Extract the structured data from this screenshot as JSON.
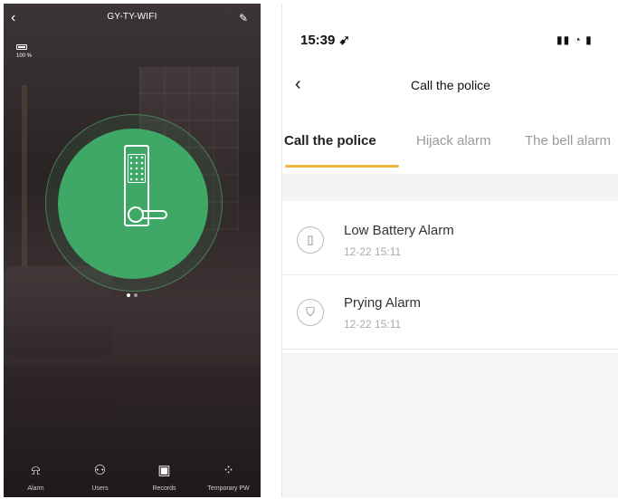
{
  "left": {
    "title": "GY-TY-WIFI",
    "battery": "100 %",
    "nav": [
      {
        "label": "Alarm",
        "icon": "alarm-icon"
      },
      {
        "label": "Users",
        "icon": "users-icon"
      },
      {
        "label": "Records",
        "icon": "calendar-icon"
      },
      {
        "label": "Temporary PW",
        "icon": "keypad-icon"
      }
    ],
    "highlight_color": "#e1141a",
    "accent": "#3fa866"
  },
  "right": {
    "status_time": "15:39",
    "nav_title": "Call the police",
    "tabs": [
      "Call the police",
      "Hijack alarm",
      "The bell alarm"
    ],
    "active_tab": 0,
    "tab_underline_color": "#f2b53c",
    "alarms": [
      {
        "title": "Low Battery Alarm",
        "time": "12-22 15:11",
        "icon": "battery-icon"
      },
      {
        "title": "Prying Alarm",
        "time": "12-22 15:11",
        "icon": "shield-icon"
      }
    ]
  }
}
